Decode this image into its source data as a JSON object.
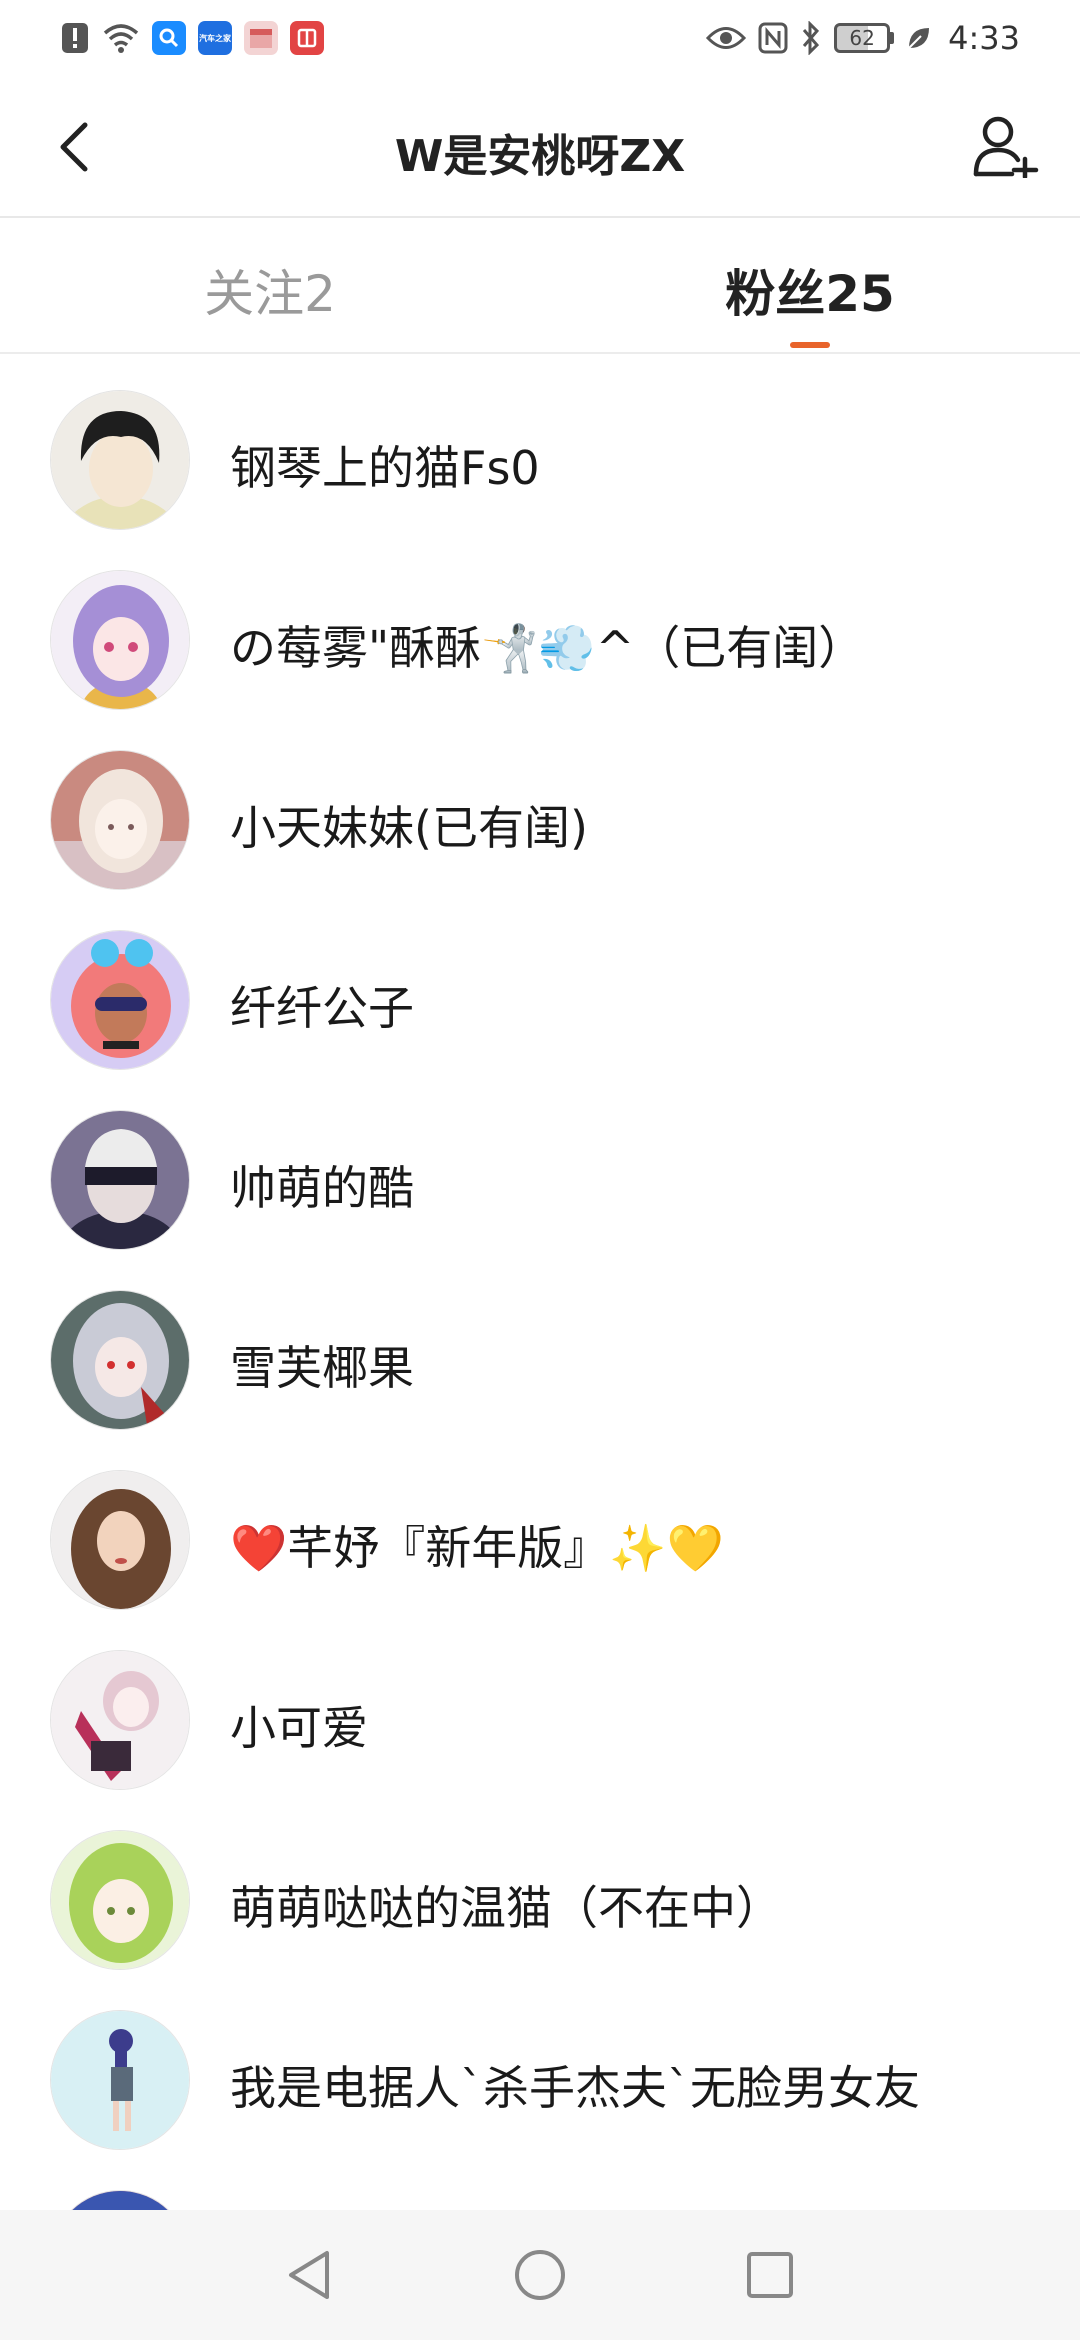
{
  "status_bar": {
    "time": "4:33",
    "battery_level": 62,
    "battery_text": "62",
    "left_icons": [
      "alert-icon",
      "wifi-icon",
      "search-app-icon",
      "autohome-app-icon",
      "box-app-icon",
      "book-app-icon"
    ],
    "right_icons": [
      "eye-icon",
      "nfc-icon",
      "bluetooth-icon",
      "battery-icon",
      "leaf-icon"
    ],
    "autohome_label": "汽车之家"
  },
  "header": {
    "title": "W是安桃呀ZX"
  },
  "tabs": {
    "following_label": "关注2",
    "fans_label": "粉丝25",
    "active": "fans",
    "indicator_color": "#e8642b"
  },
  "fans": [
    {
      "name": "钢琴上的猫Fs0"
    },
    {
      "name": "の莓雾\"酥酥🤺💨^（已有闺）"
    },
    {
      "name": "小天妹妹(已有闺)"
    },
    {
      "name": "纤纤公子"
    },
    {
      "name": "帅萌的酷"
    },
    {
      "name": "雪芙椰果"
    },
    {
      "name": "❤️芊妤『新年版』✨💛"
    },
    {
      "name": "小可爱"
    },
    {
      "name": "萌萌哒哒的温猫（不在中）"
    },
    {
      "name": "我是电据人`杀手杰夫`无脸男女友"
    }
  ],
  "nav": {
    "icons": [
      "back-triangle-icon",
      "home-circle-icon",
      "recents-square-icon"
    ]
  }
}
